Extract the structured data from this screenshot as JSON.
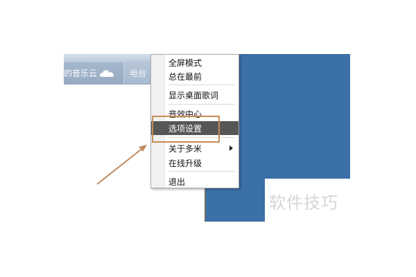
{
  "toolbar": {
    "cloud_tab_label": "的音乐云",
    "radio_tab_label": "电台"
  },
  "menu": {
    "items": [
      {
        "label": "全屏模式"
      },
      {
        "label": "总在最前"
      },
      {
        "label": "显示桌面歌词"
      },
      {
        "label": "音效中心"
      },
      {
        "label": "选项设置",
        "active": true
      },
      {
        "label": "关于多米",
        "has_submenu": true
      },
      {
        "label": "在线升级"
      },
      {
        "label": "退出"
      }
    ]
  },
  "watermark": "软件技巧",
  "colors": {
    "panel_blue": "#3b70a8",
    "highlight_frame": "#c58b55",
    "arrow": "#c08a5e",
    "active_item_bg": "#565656"
  },
  "icons": [
    "cloud-icon",
    "submenu-arrow-icon"
  ]
}
